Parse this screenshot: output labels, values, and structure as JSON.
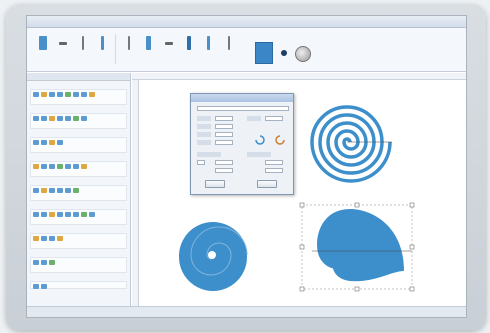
{
  "app": {
    "title": ""
  },
  "ribbon": {
    "labels": [
      "",
      "",
      "",
      "",
      "",
      "",
      "",
      "",
      "",
      "",
      "",
      ""
    ]
  },
  "panel": {
    "title": "",
    "groups": [
      "",
      "",
      "",
      "",
      "",
      "",
      "",
      "",
      ""
    ]
  },
  "dialog": {
    "title": "",
    "ok_label": "",
    "cancel_label": ""
  },
  "status": {
    "text": ""
  },
  "colors": {
    "shape_blue": "#3d8fcc",
    "accent": "#3a86c6"
  }
}
